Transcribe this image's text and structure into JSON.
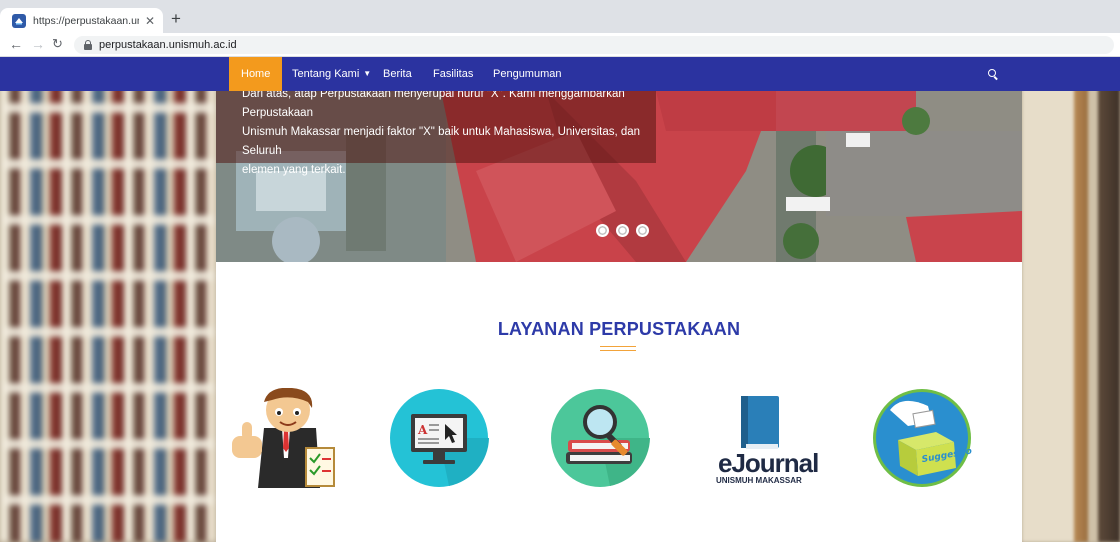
{
  "browser": {
    "tab_title": "https://perpustakaan.unismuh.ac",
    "new_tab_label": "+",
    "url": "perpustakaan.unismuh.ac.id"
  },
  "navbar": {
    "items": [
      {
        "label": "Home",
        "active": true
      },
      {
        "label": "Tentang Kami",
        "has_dropdown": true
      },
      {
        "label": "Berita"
      },
      {
        "label": "Fasilitas"
      },
      {
        "label": "Pengumuman"
      }
    ],
    "colors": {
      "bar": "#2b33a0",
      "active": "#f39a1d"
    }
  },
  "hero": {
    "caption_lines": [
      "Dari atas, atap Perpustakaan menyerupai huruf \"X\". Kami menggambarkan Perpustakaan",
      "Unismuh Makassar menjadi faktor \"X\" baik untuk Mahasiswa, Universitas, dan Seluruh",
      "elemen yang terkait."
    ],
    "slide_count": 3
  },
  "services": {
    "title": "LAYANAN PERPUSTAKAAN",
    "items": [
      {
        "icon": "thumbs-up-librarian-icon"
      },
      {
        "icon": "online-catalog-icon"
      },
      {
        "icon": "book-search-icon"
      },
      {
        "icon": "ejournal-logo",
        "logo_text": "eJournal",
        "logo_subtext": "UNISMUH MAKASSAR"
      },
      {
        "icon": "suggestion-box-icon",
        "logo_text": "Suggestion Box"
      }
    ]
  },
  "colors": {
    "title": "#2d3aa8",
    "accent": "#f39a1d"
  }
}
